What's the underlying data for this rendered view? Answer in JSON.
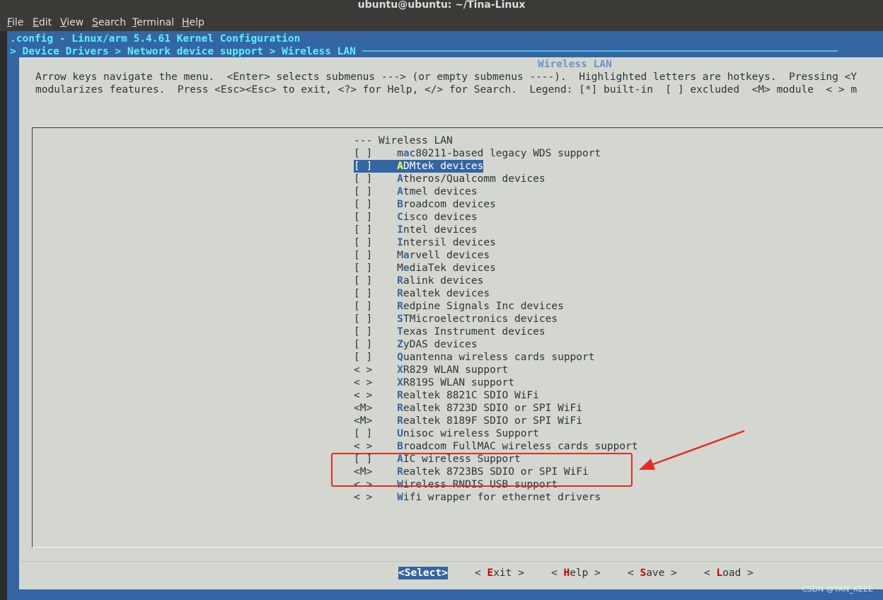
{
  "window": {
    "title": "ubuntu@ubuntu: ~/Tina-Linux"
  },
  "menubar": {
    "items": [
      {
        "first": "F",
        "rest": "ile"
      },
      {
        "first": "E",
        "rest": "dit"
      },
      {
        "first": "V",
        "rest": "iew"
      },
      {
        "first": "S",
        "rest": "earch"
      },
      {
        "first": "T",
        "rest": "erminal"
      },
      {
        "first": "H",
        "rest": "elp"
      }
    ]
  },
  "header": {
    "config_line": ".config - Linux/arm 5.4.61 Kernel Configuration",
    "breadcrumb": "> Device Drivers > Network device support > Wireless LAN ─────────────────────────────────────────────────────────────────────────────"
  },
  "dialog": {
    "title": "Wireless LAN",
    "help_line1": "Arrow keys navigate the menu.  <Enter> selects submenus ---> (or empty submenus ----).  Highlighted letters are hotkeys.  Pressing <Y",
    "help_line2": "modularizes features.  Press <Esc><Esc> to exit, <?> for Help, </> for Search.  Legend: [*] built-in  [ ] excluded  <M> module  < > m"
  },
  "menu": {
    "header": "--- Wireless LAN",
    "items": [
      {
        "mark": "[ ]",
        "pre": "m",
        "hk": "a",
        "post": "c80211-based legacy WDS support"
      },
      {
        "mark": "[ ]",
        "pre": "",
        "hk": "A",
        "post": "DMtek devices",
        "selected": true
      },
      {
        "mark": "[ ]",
        "pre": "",
        "hk": "A",
        "post": "theros/Qualcomm devices"
      },
      {
        "mark": "[ ]",
        "pre": "",
        "hk": "A",
        "post": "tmel devices"
      },
      {
        "mark": "[ ]",
        "pre": "",
        "hk": "B",
        "post": "roadcom devices"
      },
      {
        "mark": "[ ]",
        "pre": "",
        "hk": "C",
        "post": "isco devices"
      },
      {
        "mark": "[ ]",
        "pre": "",
        "hk": "I",
        "post": "ntel devices"
      },
      {
        "mark": "[ ]",
        "pre": "",
        "hk": "I",
        "post": "ntersil devices"
      },
      {
        "mark": "[ ]",
        "pre": "M",
        "hk": "a",
        "post": "rvell devices"
      },
      {
        "mark": "[ ]",
        "pre": "M",
        "hk": "e",
        "post": "diaTek devices"
      },
      {
        "mark": "[ ]",
        "pre": "",
        "hk": "R",
        "post": "alink devices"
      },
      {
        "mark": "[ ]",
        "pre": "",
        "hk": "R",
        "post": "ealtek devices"
      },
      {
        "mark": "[ ]",
        "pre": "",
        "hk": "R",
        "post": "edpine Signals Inc devices"
      },
      {
        "mark": "[ ]",
        "pre": "",
        "hk": "S",
        "post": "TMicroelectronics devices"
      },
      {
        "mark": "[ ]",
        "pre": "",
        "hk": "T",
        "post": "exas Instrument devices"
      },
      {
        "mark": "[ ]",
        "pre": "",
        "hk": "Z",
        "post": "yDAS devices"
      },
      {
        "mark": "[ ]",
        "pre": "",
        "hk": "Q",
        "post": "uantenna wireless cards support"
      },
      {
        "mark": "< >",
        "pre": "",
        "hk": "X",
        "post": "R829 WLAN support"
      },
      {
        "mark": "< >",
        "pre": "",
        "hk": "X",
        "post": "R819S WLAN support"
      },
      {
        "mark": "< >",
        "pre": "",
        "hk": "R",
        "post": "ealtek 8821C SDIO WiFi"
      },
      {
        "mark": "<M>",
        "pre": "",
        "hk": "R",
        "post": "ealtek 8723D SDIO or SPI WiFi"
      },
      {
        "mark": "<M>",
        "pre": "",
        "hk": "R",
        "post": "ealtek 8189F SDIO or SPI WiFi"
      },
      {
        "mark": "[ ]",
        "pre": "",
        "hk": "U",
        "post": "nisoc wireless Support"
      },
      {
        "mark": "< >",
        "pre": "",
        "hk": "B",
        "post": "roadcom FullMAC wireless cards support"
      },
      {
        "mark": "[ ]",
        "pre": "",
        "hk": "A",
        "post": "IC wireless Support"
      },
      {
        "mark": "<M>",
        "pre": "",
        "hk": "R",
        "post": "ealtek 8723BS SDIO or SPI WiFi"
      },
      {
        "mark": "< >",
        "pre": "",
        "hk": "W",
        "post": "ireless RNDIS USB support"
      },
      {
        "mark": "< >",
        "pre": "",
        "hk": "W",
        "post": "ifi wrapper for ethernet drivers"
      }
    ]
  },
  "buttons": [
    {
      "open": "<",
      "hk": "S",
      "rest": "elect",
      ">": ">",
      "close": ">",
      "selected": true
    },
    {
      "open": "< ",
      "hk": "E",
      "rest": "xit",
      "close": " >"
    },
    {
      "open": "< ",
      "hk": "H",
      "rest": "elp",
      "close": " >"
    },
    {
      "open": "< ",
      "hk": "S",
      "rest": "ave",
      "close": " >"
    },
    {
      "open": "< ",
      "hk": "L",
      "rest": "oad",
      "close": " >"
    }
  ],
  "annotation": {
    "color": "#e52b25"
  },
  "watermark": "CSDN @YAN_KEEE"
}
